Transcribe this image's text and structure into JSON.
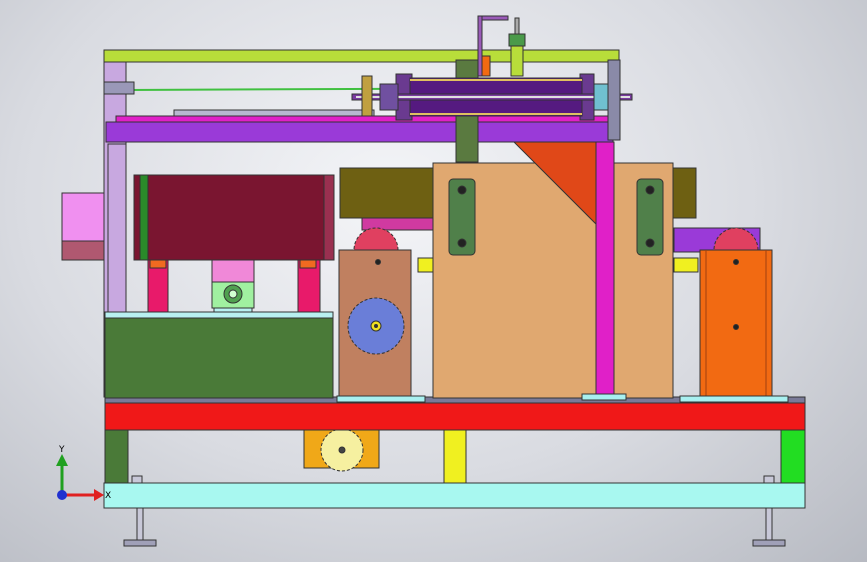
{
  "colors": {
    "top_rail": "#b8dd3a",
    "pink_bar": "#e020c8",
    "dark_purple_cylinder": "#551a80",
    "maroon_box": "#7a1530",
    "tan_plate": "#e0a870",
    "olive_block": "#6e6012",
    "orange_box": "#f26a12",
    "copper_box": "#c08060",
    "blue_gear": "#6a7ed8",
    "red_beam": "#f01818",
    "green_block": "#4a7a38",
    "cyan_base": "#a8f8f0",
    "yellow_post": "#f0f020",
    "gold_gear": "#f6f0a0",
    "lavender_box": "#f090f0",
    "green_leg": "#22dd22",
    "axis_x_color": "#e02020",
    "axis_y_color": "#20a020",
    "axis_z_color": "#2030d0"
  },
  "axis_triad": {
    "x_label": "X",
    "y_label": "Y"
  }
}
